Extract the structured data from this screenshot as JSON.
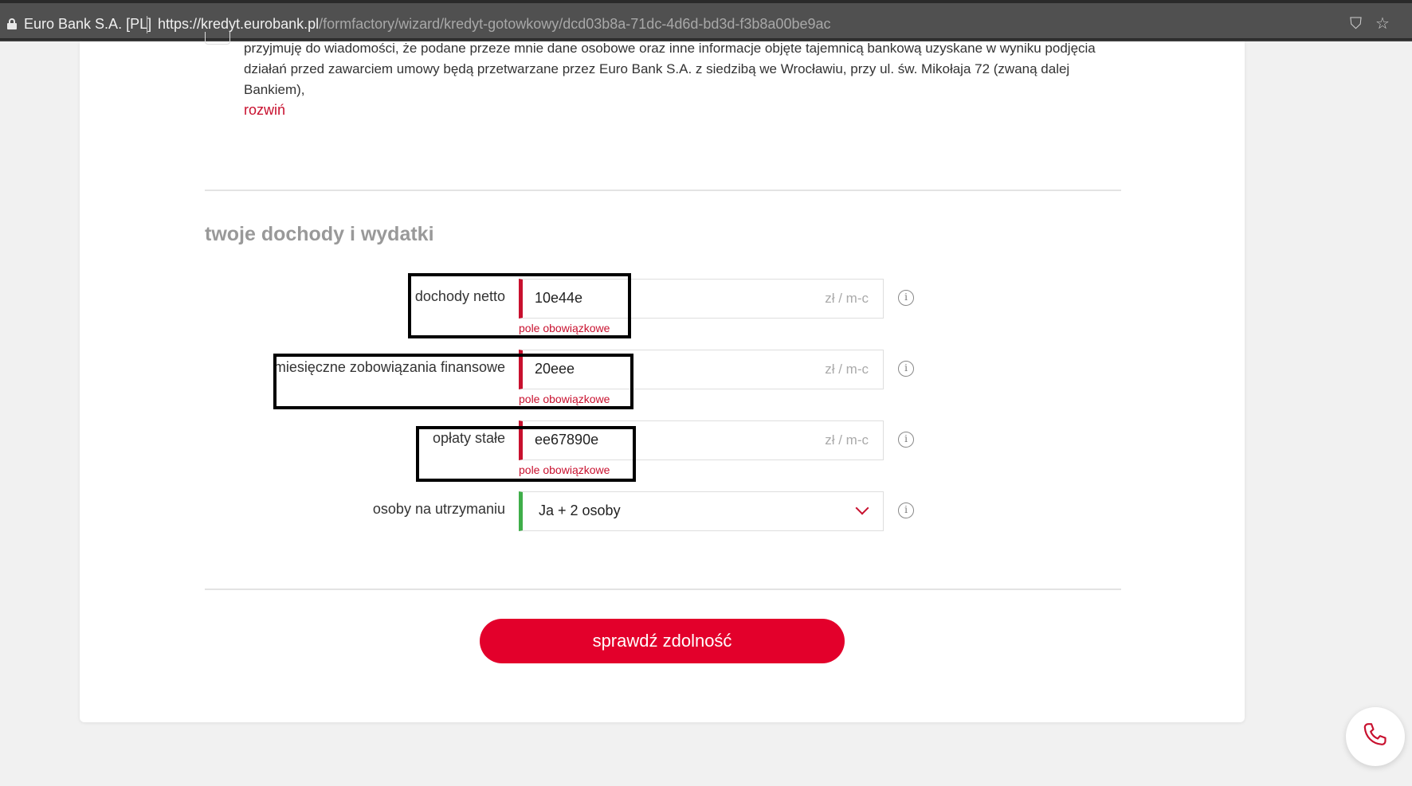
{
  "browser": {
    "site_name": "Euro Bank S.A. [PL]",
    "url_host": "https://kredyt.eurobank.pl",
    "url_path": "/formfactory/wizard/kredyt-gotowkowy/dcd03b8a-71dc-4d6d-bd3d-f3b8a00be9ac"
  },
  "consent": {
    "text": "przyjmuję do wiadomości, że podane przeze mnie dane osobowe oraz inne informacje objęte tajemnicą bankową uzyskane w wyniku podjęcia działań przed zawarciem umowy będą przetwarzane przez Euro Bank S.A. z siedzibą we Wrocławiu, przy ul. św. Mikołaja 72 (zwaną dalej Bankiem),",
    "expand_label": "rozwiń"
  },
  "section": {
    "title": "twoje dochody i wydatki"
  },
  "fields": [
    {
      "label": "dochody netto",
      "value": "10e44e",
      "unit": "zł / m-c",
      "error": "pole obowiązkowe"
    },
    {
      "label": "miesięczne zobowiązania finansowe",
      "value": "20eee",
      "unit": "zł / m-c",
      "error": "pole obowiązkowe"
    },
    {
      "label": "opłaty stałe",
      "value": "ee67890e",
      "unit": "zł / m-c",
      "error": "pole obowiązkowe"
    },
    {
      "label": "osoby na utrzymaniu",
      "value": "Ja + 2 osoby"
    }
  ],
  "info_icon": "i",
  "submit_label": "sprawdź zdolność",
  "colors": {
    "brand_red": "#e3002b",
    "error_red": "#c8102e",
    "valid_green": "#3fae49"
  }
}
